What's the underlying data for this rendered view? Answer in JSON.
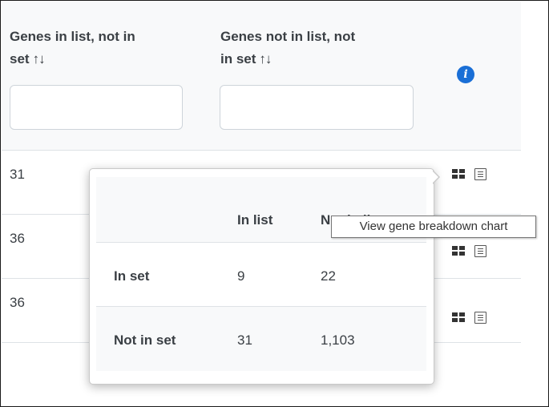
{
  "header": {
    "col1_label": "Genes in list, not in set",
    "col1_line1": "Genes in list, not in",
    "col1_line2": "set",
    "col2_line1": "Genes not in list, not",
    "col2_line2": "in set",
    "sort_glyph": "↑↓",
    "filter1_value": "",
    "filter2_value": "",
    "info_glyph": "i"
  },
  "rows": [
    {
      "value": "31"
    },
    {
      "value": "36"
    },
    {
      "value": "36"
    }
  ],
  "icons": {
    "info": "info-circle-icon",
    "breakdown": "grid-icon",
    "list": "list-icon"
  },
  "popover": {
    "col_in_list": "In list",
    "col_not_in_list": "Not in list",
    "row1_label": "In set",
    "row1_in_list": "9",
    "row1_not_in_list": "22",
    "row2_label": "Not in set",
    "row2_in_list": "31",
    "row2_not_in_list": "1,103"
  },
  "tooltip": {
    "text": "View gene breakdown chart"
  },
  "colors": {
    "info_blue": "#1a6fd6",
    "header_bg": "#f8f9fa",
    "border": "#dee2e6"
  }
}
